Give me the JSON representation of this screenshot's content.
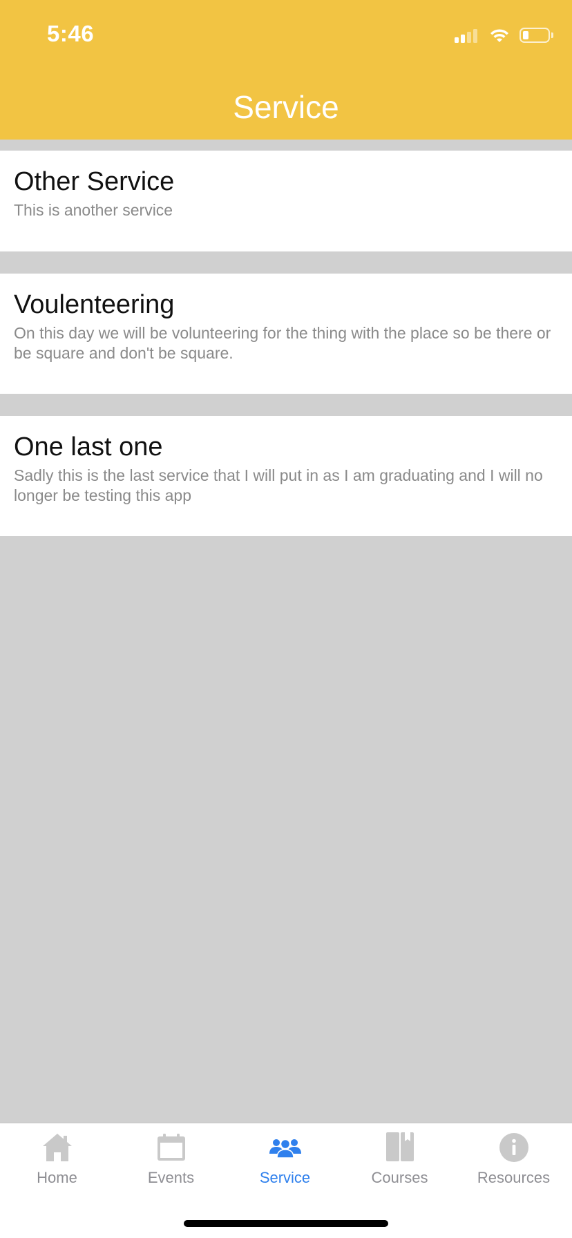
{
  "status_bar": {
    "time": "5:46",
    "battery_level": 0.25
  },
  "nav": {
    "title": "Service"
  },
  "colors": {
    "header": "#f2c443",
    "active_tab": "#2f80ed",
    "inactive_tab": "#8e8e93"
  },
  "services": [
    {
      "title": "Other Service",
      "description": "This is another service"
    },
    {
      "title": "Voulenteering",
      "description": "On this day we will be volunteering for the thing with the place so be there or be square and don't be square."
    },
    {
      "title": "One last one",
      "description": "Sadly this is the last service that I will put in as I am graduating and I will no longer be testing this app"
    }
  ],
  "tabs": [
    {
      "label": "Home",
      "icon": "house-icon",
      "active": false
    },
    {
      "label": "Events",
      "icon": "calendar-icon",
      "active": false
    },
    {
      "label": "Service",
      "icon": "people-icon",
      "active": true
    },
    {
      "label": "Courses",
      "icon": "book-icon",
      "active": false
    },
    {
      "label": "Resources",
      "icon": "info-icon",
      "active": false
    }
  ]
}
